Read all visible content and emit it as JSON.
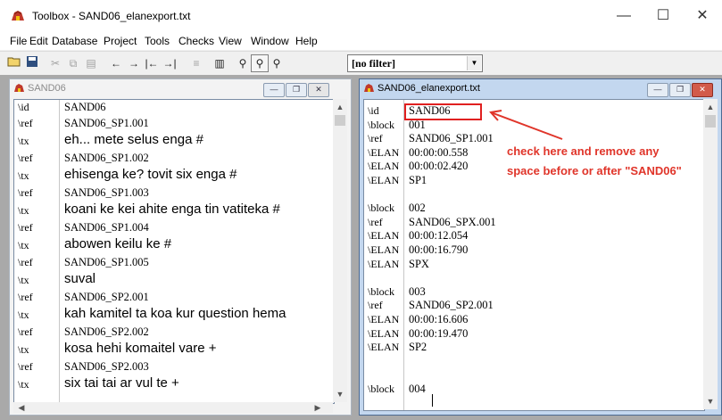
{
  "app": {
    "title": "Toolbox - SAND06_elanexport.txt"
  },
  "window_controls": {
    "minimize": "—",
    "maximize": "☐",
    "close": "✕"
  },
  "menu": [
    "File",
    "Edit",
    "Database",
    "Project",
    "Tools",
    "Checks",
    "View",
    "Window",
    "Help"
  ],
  "toolbar": {
    "filter_value": "[no filter]"
  },
  "left_window": {
    "title": "SAND06",
    "rows": [
      {
        "marker": "\\id",
        "value": "SAND06",
        "style": "serif"
      },
      {
        "marker": "\\ref",
        "value": "SAND06_SP1.001",
        "style": "serif"
      },
      {
        "marker": "\\tx",
        "value": "eh... mete selus enga #",
        "style": "sans"
      },
      {
        "marker": "\\ref",
        "value": "SAND06_SP1.002",
        "style": "serif"
      },
      {
        "marker": "\\tx",
        "value": "ehisenga ke? tovit six enga #",
        "style": "sans"
      },
      {
        "marker": "\\ref",
        "value": "SAND06_SP1.003",
        "style": "serif"
      },
      {
        "marker": "\\tx",
        "value": "koani ke kei ahite enga tin vatiteka #",
        "style": "sans"
      },
      {
        "marker": "\\ref",
        "value": "SAND06_SP1.004",
        "style": "serif"
      },
      {
        "marker": "\\tx",
        "value": "abowen keilu ke #",
        "style": "sans"
      },
      {
        "marker": "\\ref",
        "value": "SAND06_SP1.005",
        "style": "serif"
      },
      {
        "marker": "\\tx",
        "value": "suval",
        "style": "sans"
      },
      {
        "marker": "\\ref",
        "value": "SAND06_SP2.001",
        "style": "serif"
      },
      {
        "marker": "\\tx",
        "value": "kah kamitel ta koa kur question hema",
        "style": "sans"
      },
      {
        "marker": "\\ref",
        "value": "SAND06_SP2.002",
        "style": "serif"
      },
      {
        "marker": "\\tx",
        "value": "kosa hehi komaitel vare +",
        "style": "sans"
      },
      {
        "marker": "\\ref",
        "value": "SAND06_SP2.003",
        "style": "serif"
      },
      {
        "marker": "\\tx",
        "value": "six tai tai ar vul te +",
        "style": "sans"
      }
    ]
  },
  "right_window": {
    "title": "SAND06_elanexport.txt",
    "rows": [
      {
        "marker": "\\id",
        "value": "SAND06"
      },
      {
        "marker": "\\block",
        "value": "001"
      },
      {
        "marker": "\\ref",
        "value": "SAND06_SP1.001"
      },
      {
        "marker": "\\ELAN",
        "value": "00:00:00.558"
      },
      {
        "marker": "\\ELAN",
        "value": "00:00:02.420"
      },
      {
        "marker": "\\ELAN",
        "value": "SP1"
      },
      {
        "marker": "",
        "value": ""
      },
      {
        "marker": "\\block",
        "value": "002"
      },
      {
        "marker": "\\ref",
        "value": "SAND06_SPX.001"
      },
      {
        "marker": "\\ELAN",
        "value": "00:00:12.054"
      },
      {
        "marker": "\\ELAN",
        "value": "00:00:16.790"
      },
      {
        "marker": "\\ELAN",
        "value": "SPX"
      },
      {
        "marker": "",
        "value": ""
      },
      {
        "marker": "\\block",
        "value": "003"
      },
      {
        "marker": "\\ref",
        "value": "SAND06_SP2.001"
      },
      {
        "marker": "\\ELAN",
        "value": "00:00:16.606"
      },
      {
        "marker": "\\ELAN",
        "value": "00:00:19.470"
      },
      {
        "marker": "\\ELAN",
        "value": "SP2"
      },
      {
        "marker": "",
        "value": ""
      },
      {
        "marker": "",
        "value": ""
      },
      {
        "marker": "\\block",
        "value": "004"
      }
    ]
  },
  "annotation": {
    "line1": "check here and remove any",
    "line2": "space before or after \"SAND06\"",
    "color": "#e0352a"
  }
}
